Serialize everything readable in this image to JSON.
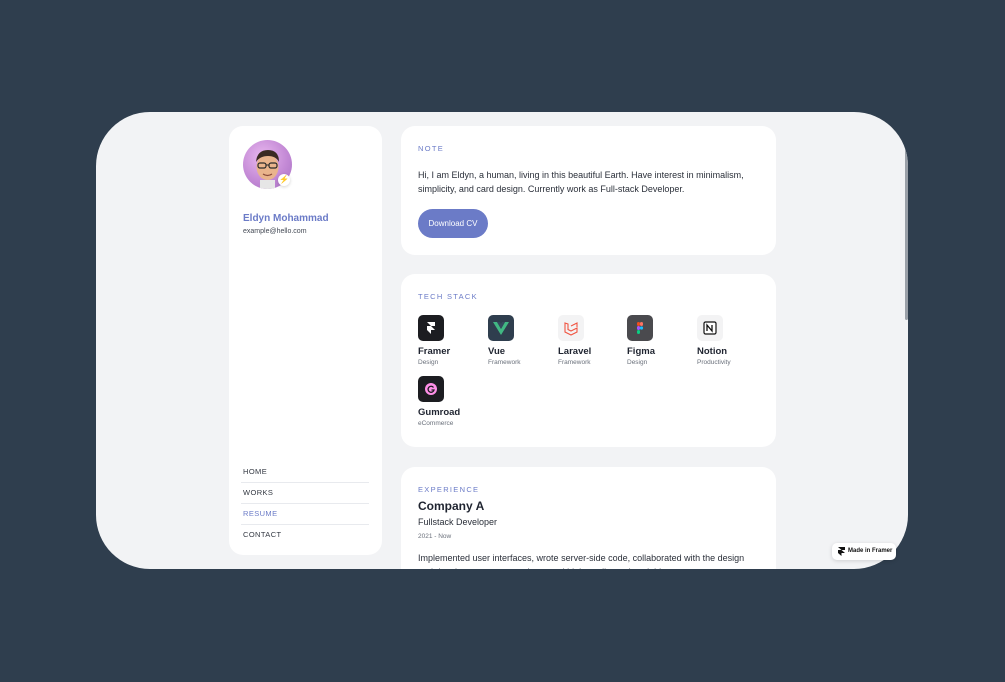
{
  "profile": {
    "name": "Eldyn Mohammad",
    "email": "example@hello.com",
    "avatar_icon": "memoji-avatar",
    "badge_icon": "lightning-icon"
  },
  "nav": {
    "items": [
      {
        "label": "HOME",
        "active": false
      },
      {
        "label": "WORKS",
        "active": false
      },
      {
        "label": "RESUME",
        "active": true
      },
      {
        "label": "CONTACT",
        "active": false
      }
    ]
  },
  "note": {
    "label": "NOTE",
    "text": "Hi, I am Eldyn, a human, living in this beautiful Earth. Have interest in minimalism, simplicity, and card design. Currently work as Full-stack Developer.",
    "button": "Download CV"
  },
  "tech_stack": {
    "label": "TECH STACK",
    "items": [
      {
        "name": "Framer",
        "category": "Design",
        "icon": "framer-icon",
        "bg": "#1c1d21"
      },
      {
        "name": "Vue",
        "category": "Framework",
        "icon": "vue-icon",
        "bg": "#2f3e4e"
      },
      {
        "name": "Laravel",
        "category": "Framework",
        "icon": "laravel-icon",
        "bg": "#f3f3f4"
      },
      {
        "name": "Figma",
        "category": "Design",
        "icon": "figma-icon",
        "bg": "#4a4a4e"
      },
      {
        "name": "Notion",
        "category": "Productivity",
        "icon": "notion-icon",
        "bg": "#f3f3f4"
      },
      {
        "name": "Gumroad",
        "category": "eCommerce",
        "icon": "gumroad-icon",
        "bg": "#1c1d21"
      }
    ]
  },
  "experience": {
    "label": "EXPERIENCE",
    "company": "Company A",
    "role": "Fullstack Developer",
    "date": "2021 - Now",
    "description": "Implemented user interfaces, wrote server-side code, collaborated with the design and development team, and ensured high-quality and scalable"
  },
  "framer_badge": {
    "label": "Made in Framer",
    "icon": "framer-logo-icon"
  },
  "colors": {
    "accent": "#6b7bc7",
    "page_bg": "#2f3e4e",
    "canvas_bg": "#f2f3f5",
    "card_bg": "#ffffff"
  }
}
